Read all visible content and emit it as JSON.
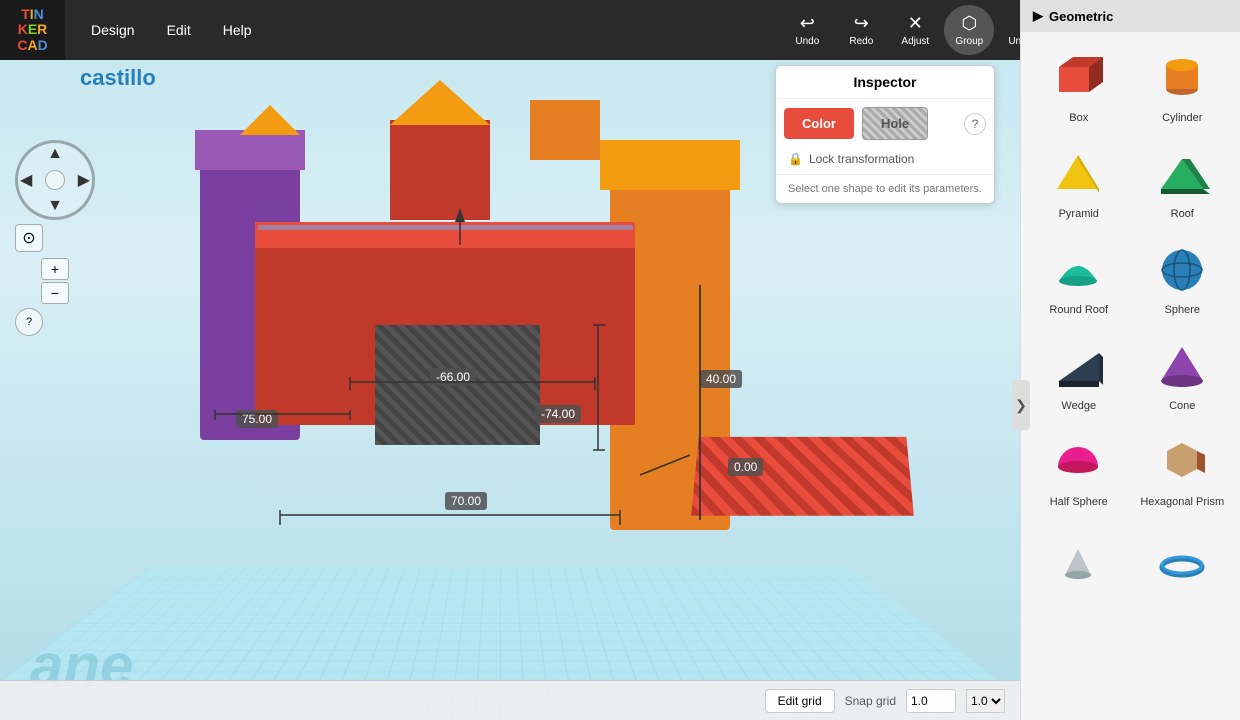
{
  "app": {
    "logo": "TINKERCAD",
    "logo_line1": "TIN",
    "logo_line2": "KER",
    "logo_line3": "CAD"
  },
  "menu": {
    "items": [
      "Design",
      "Edit",
      "Help"
    ]
  },
  "toolbar": {
    "undo_label": "Undo",
    "redo_label": "Redo",
    "adjust_label": "Adjust",
    "group_label": "Group",
    "ungroup_label": "Ungroup"
  },
  "project": {
    "title": "castillo"
  },
  "inspector": {
    "title": "Inspector",
    "color_label": "Color",
    "hole_label": "Hole",
    "lock_label": "Lock transformation",
    "hint": "Select one shape to edit its parameters."
  },
  "dimensions": {
    "d1": "-66.00",
    "d2": "-74.00",
    "d3": "75.00",
    "d4": "40.00",
    "d5": "0.00",
    "d6": "70.00"
  },
  "shapes_panel": {
    "header": "Geometric",
    "items": [
      {
        "label": "Box",
        "color": "#e74c3c",
        "shape": "box"
      },
      {
        "label": "Cylinder",
        "color": "#e67e22",
        "shape": "cylinder"
      },
      {
        "label": "Pyramid",
        "color": "#f1c40f",
        "shape": "pyramid"
      },
      {
        "label": "Roof",
        "color": "#27ae60",
        "shape": "roof"
      },
      {
        "label": "Round Roof",
        "color": "#1abc9c",
        "shape": "round-roof"
      },
      {
        "label": "Sphere",
        "color": "#2980b9",
        "shape": "sphere"
      },
      {
        "label": "Wedge",
        "color": "#2c3e50",
        "shape": "wedge"
      },
      {
        "label": "Cone",
        "color": "#8e44ad",
        "shape": "cone"
      },
      {
        "label": "Half Sphere",
        "color": "#e91e8c",
        "shape": "half-sphere"
      },
      {
        "label": "Hexagonal Prism",
        "color": "#a0522d",
        "shape": "hex-prism"
      }
    ],
    "bottom_items": [
      {
        "label": "",
        "shape": "cone-small"
      },
      {
        "label": "",
        "shape": "torus"
      }
    ]
  },
  "bottom": {
    "edit_grid": "Edit grid",
    "snap_label": "Snap grid",
    "snap_value": "1.0"
  },
  "help_icon": "?",
  "panel_toggle": "❯"
}
